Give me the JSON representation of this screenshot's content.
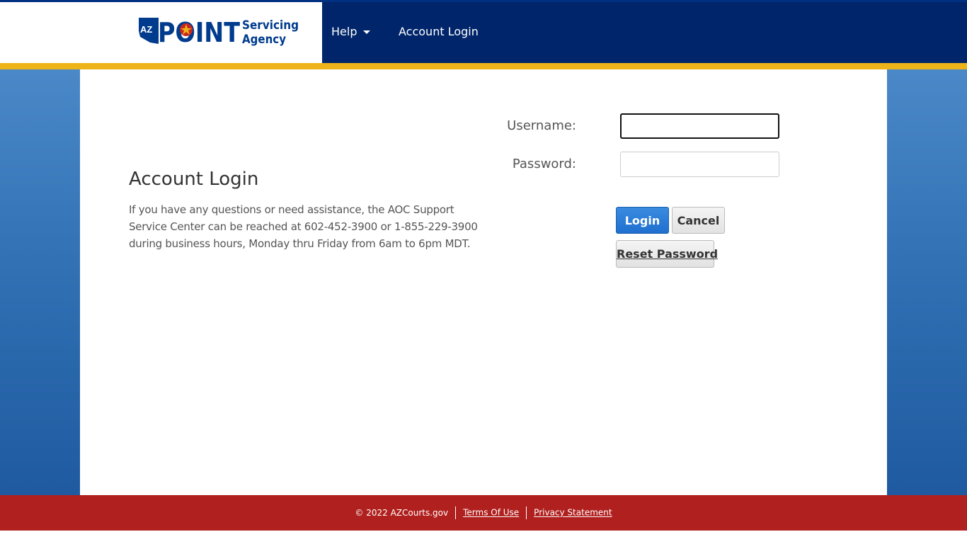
{
  "header": {
    "logo": {
      "az_text": "AZ",
      "point_text": "POINT",
      "servicing_text": "Servicing",
      "agency_text": "Agency"
    },
    "nav": {
      "help_label": "Help",
      "login_label": "Account Login"
    }
  },
  "main": {
    "title": "Account Login",
    "help_text": "If you have any questions or need assistance, the AOC Support Service Center can be reached at 602-452-3900 or 1-855-229-3900 during business hours, Monday thru Friday from 6am to 6pm MDT.",
    "form": {
      "username_label": "Username:",
      "username_value": "",
      "password_label": "Password:",
      "password_value": "",
      "login_button": "Login",
      "cancel_button": "Cancel",
      "reset_button": "Reset Password"
    }
  },
  "footer": {
    "copyright": "© 2022 AZCourts.gov",
    "terms_link": "Terms Of Use",
    "privacy_link": "Privacy Statement"
  },
  "colors": {
    "header_navy": "#00256a",
    "gold_stripe": "#efb31a",
    "footer_red": "#b0201e",
    "primary_button": "#1f6fcf",
    "logo_blue": "#003b8e"
  }
}
